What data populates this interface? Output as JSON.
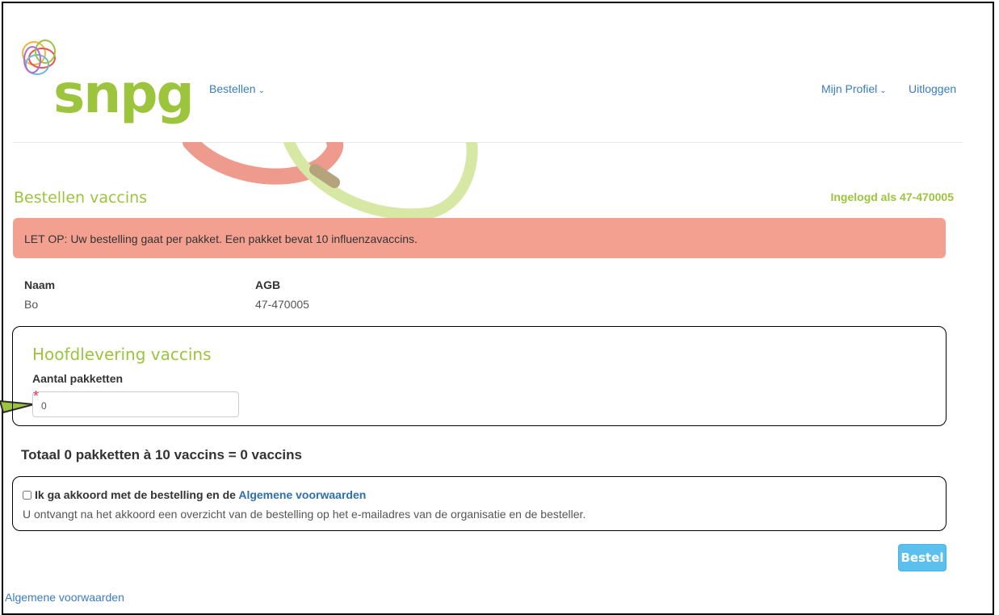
{
  "header": {
    "logo_text": "snpg",
    "nav": {
      "bestellen_label": "Bestellen",
      "profile_label": "Mijn Profiel",
      "logout_label": "Uitloggen"
    }
  },
  "page": {
    "title": "Bestellen vaccins",
    "logged_in": "Ingelogd als 47-470005"
  },
  "alert": {
    "text": "LET OP: Uw bestelling gaat per pakket. Een pakket bevat 10 influenzavaccins."
  },
  "info": {
    "naam_label": "Naam",
    "naam_value": "Bo",
    "agb_label": "AGB",
    "agb_value": "47-470005"
  },
  "delivery": {
    "title": "Hoofdlevering vaccins",
    "quantity_label": "Aantal pakketten",
    "required_mark": "*",
    "quantity_value": "0"
  },
  "total": {
    "text": "Totaal 0 pakketten à 10 vaccins = 0 vaccins"
  },
  "agreement": {
    "checked": false,
    "prefix": "Ik ga akkoord met de bestelling en de",
    "link": "Algemene voorwaarden",
    "note": "U ontvangt na het akkoord een overzicht van de bestelling op het e-mailadres van de organisatie en de besteller."
  },
  "actions": {
    "order_label": "Bestel"
  },
  "footer": {
    "terms_link": "Algemene voorwaarden"
  },
  "colors": {
    "brand_green": "#9cc43c",
    "alert_bg": "#f4a090",
    "link_blue": "#3a7cc2",
    "button_blue": "#5bc0eb"
  },
  "icons": {
    "logo": "snpg-circles-logo",
    "nav_chevron": "chevron-down-icon",
    "callout": "callout-arrow-icon"
  }
}
